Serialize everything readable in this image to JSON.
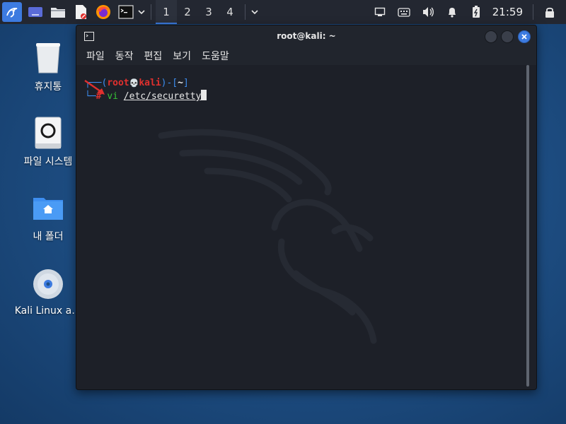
{
  "panel": {
    "workspaces": [
      "1",
      "2",
      "3",
      "4"
    ],
    "active_workspace": "1",
    "clock": "21:59"
  },
  "desktop": {
    "icons": [
      {
        "label": "휴지통",
        "icon": "trash-icon"
      },
      {
        "label": "파일 시스템",
        "icon": "drive-icon"
      },
      {
        "label": "내 폴더",
        "icon": "home-folder-icon"
      },
      {
        "label": "Kali Linux a…",
        "icon": "disc-icon"
      }
    ]
  },
  "terminal": {
    "title": "root@kali: ~",
    "menu": [
      "파일",
      "동작",
      "편집",
      "보기",
      "도움말"
    ],
    "prompt_open": "┌──(",
    "prompt_user": "root",
    "prompt_skull": "💀",
    "prompt_host": "kali",
    "prompt_close": ")-[",
    "prompt_dir": "~",
    "prompt_end": "]",
    "prompt_line2": "└─",
    "prompt_hash": "#",
    "command": "vi",
    "argument": "/etc/securetty"
  },
  "colors": {
    "accent": "#3d7be0",
    "prompt_user": "#e0302e",
    "prompt_frame": "#3d8df0",
    "command": "#36c236",
    "panel_bg": "#232731",
    "terminal_bg": "#1d2028"
  }
}
